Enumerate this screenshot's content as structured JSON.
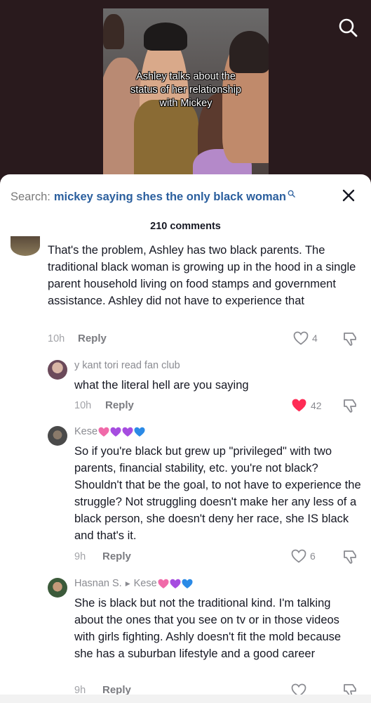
{
  "video": {
    "caption": "Ashley talks about the\nstatus of her relationship\nwith Mickey"
  },
  "search": {
    "prefix": "Search:",
    "query": "mickey saying shes the only black woman"
  },
  "comments_header": {
    "count_label": "210 comments"
  },
  "comments": [
    {
      "text": "That's the problem, Ashley has two black parents. The traditional black woman is growing up in the hood in a single parent household living on food stamps and government assistance. Ashley did not have to experience that",
      "time": "10h",
      "reply_label": "Reply",
      "likes": "4",
      "liked": false
    },
    {
      "author": "y kant tori read fan club",
      "text": "what the literal hell are you saying",
      "time": "10h",
      "reply_label": "Reply",
      "likes": "42",
      "liked": true
    },
    {
      "author": "Kese",
      "text": "So if you're black but grew up \"privileged\" with two parents, financial stability, etc. you're not black? Shouldn't that be the goal, to not have to experience the struggle? Not struggling doesn't make her any less of a black person, she doesn't deny her race, she IS black and that's it.",
      "time": "9h",
      "reply_label": "Reply",
      "likes": "6",
      "liked": false
    },
    {
      "author": "Hasnan S.",
      "reply_to": "Kese",
      "text": "She is black but not the traditional kind. I'm talking about the ones that you see on tv or in those videos with girls fighting. Ashly doesn't fit the mold because she has a suburban lifestyle and a good career",
      "time": "9h",
      "reply_label": "Reply"
    }
  ],
  "colors": {
    "accent_link": "#2b5f9e",
    "like_active": "#fe2c55",
    "text_primary": "#161823",
    "text_secondary": "#8a8b91",
    "backdrop": "#291a1d"
  },
  "icons": [
    "search-icon",
    "close-icon",
    "heart-icon",
    "heart-filled-icon",
    "dislike-icon",
    "purple-heart-emoji",
    "blue-heart-emoji",
    "sparkling-heart-emoji"
  ]
}
